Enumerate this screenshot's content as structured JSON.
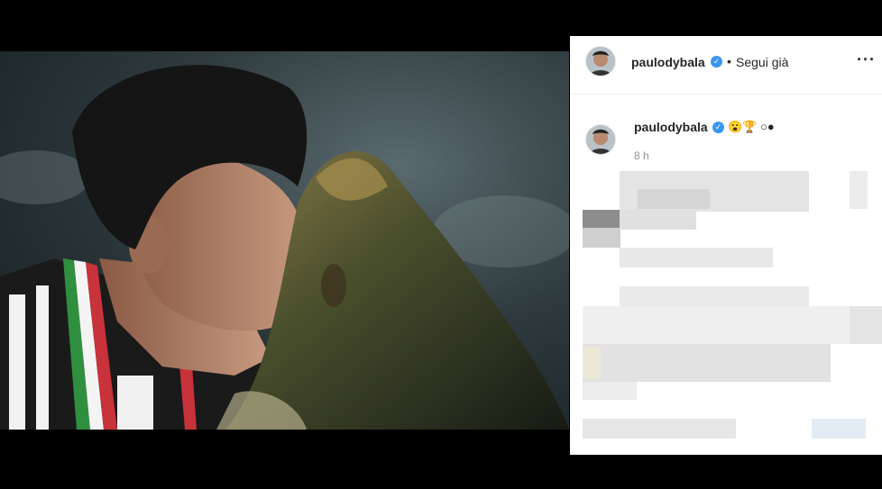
{
  "post": {
    "header": {
      "username": "paulodybala",
      "separator": "•",
      "follow_label": "Segui già",
      "more_icon": "more-horizontal-icon"
    },
    "caption": {
      "username": "paulodybala",
      "text": "😮🏆 ○●",
      "time": "8 h"
    }
  },
  "colors": {
    "verified": "#3897f0",
    "username": "#262626",
    "secondary_text": "#8e8e8e",
    "divider": "#efefef"
  }
}
